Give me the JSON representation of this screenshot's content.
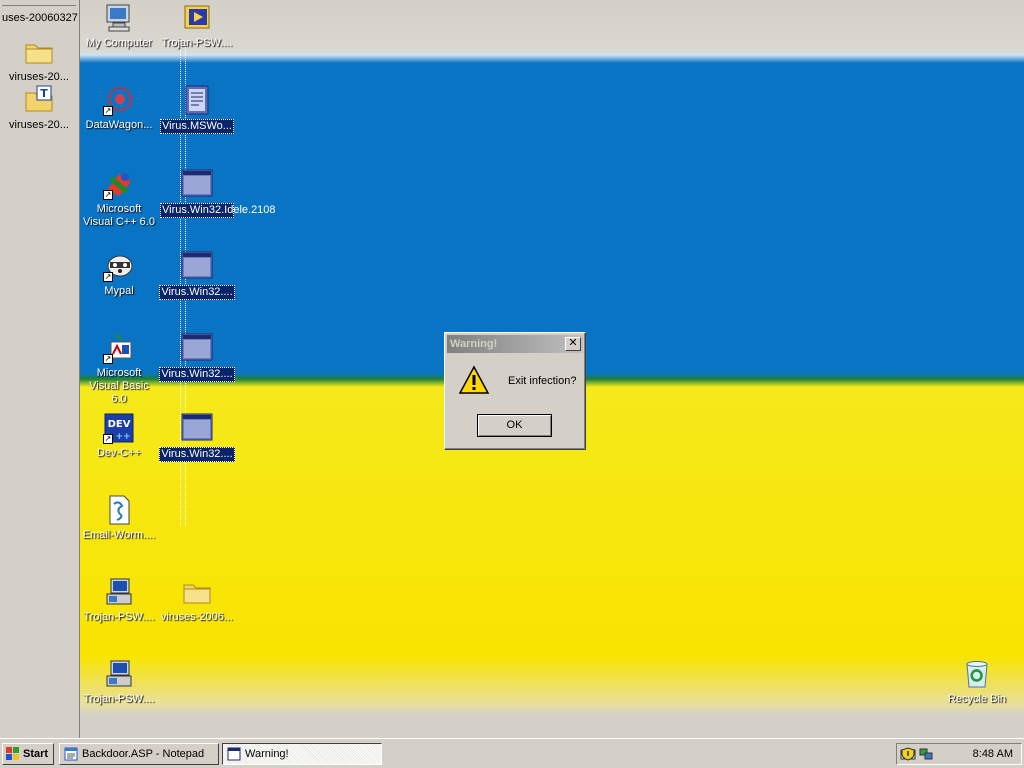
{
  "left_pane": {
    "top_label": "uses-20060327.",
    "items": [
      {
        "label": "viruses-20...",
        "icon": "folder-icon"
      },
      {
        "label": "viruses-20...",
        "icon": "text-file-icon"
      }
    ]
  },
  "desktop": {
    "icons_col1": [
      {
        "label": "My Computer",
        "icon": "my-computer-icon"
      },
      {
        "label": "DataWagon...",
        "icon": "datawagon-icon"
      },
      {
        "label": "Microsoft Visual C++ 6.0",
        "icon": "visual-cpp-icon"
      },
      {
        "label": "Mypal",
        "icon": "mypal-icon"
      },
      {
        "label": "Microsoft Visual Basic 6.0",
        "icon": "visual-basic-icon"
      },
      {
        "label": "Dev-C++",
        "icon": "dev-cpp-icon"
      },
      {
        "label": "Email-Worm....",
        "icon": "script-file-icon"
      },
      {
        "label": "Trojan-PSW....",
        "icon": "installer-icon"
      },
      {
        "label": "Trojan-PSW....",
        "icon": "installer-icon"
      }
    ],
    "icons_col2": [
      {
        "label": "Trojan-PSW....",
        "icon": "media-file-icon"
      },
      {
        "label": "Virus.MSWo...",
        "icon": "document-icon"
      },
      {
        "label": "Virus.Win32.Idele.2108",
        "icon": "window-exe-icon"
      },
      {
        "label": "Virus.Win32....",
        "icon": "window-exe-icon"
      },
      {
        "label": "Virus.Win32....",
        "icon": "window-exe-icon"
      },
      {
        "label": "Virus.Win32....",
        "icon": "window-exe-icon"
      },
      {
        "label": "viruses-2006...",
        "icon": "folder-icon"
      }
    ],
    "recycle_bin": {
      "label": "Recycle Bin",
      "icon": "recycle-bin-icon"
    }
  },
  "dialog": {
    "title": "Warning!",
    "message": "Exit infection?",
    "ok_label": "OK",
    "close_label": "✕"
  },
  "taskbar": {
    "start_label": "Start",
    "tasks": [
      {
        "label": "Backdoor.ASP - Notepad",
        "icon": "notepad-icon"
      },
      {
        "label": "Warning!",
        "icon": "window-icon"
      }
    ],
    "clock": "8:48 AM"
  },
  "colors": {
    "wallpaper_blue": "#0a74c4",
    "wallpaper_yellow": "#f8e400",
    "selection": "#0a246a",
    "chrome": "#d4d0c8"
  }
}
